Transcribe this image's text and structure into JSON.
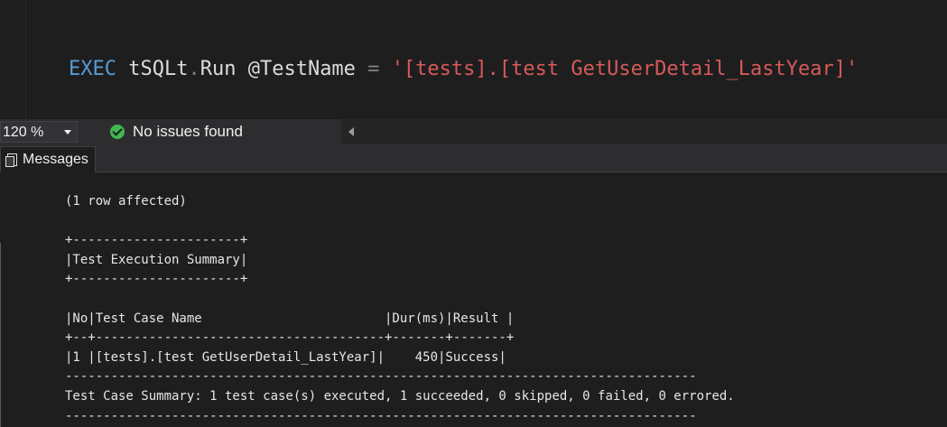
{
  "editor": {
    "code": {
      "keyword": "EXEC",
      "object": "tSQLt",
      "dot": ".",
      "procedure": "Run",
      "param": "@TestName",
      "equals": "=",
      "value": "'[tests].[test GetUserDetail_LastYear]'"
    },
    "colors": {
      "keyword": "#569cd6",
      "string": "#d65a5a",
      "operator": "#7f7f7f"
    }
  },
  "statusbar": {
    "zoom": "120 %",
    "issues_text": "No issues found",
    "issues_icon": "check-circle-icon",
    "issues_color": "#3fb950"
  },
  "results": {
    "tabs": [
      {
        "label": "Messages",
        "icon": "messages-icon"
      }
    ]
  },
  "messages": {
    "lines": [
      "(1 row affected)",
      "",
      "+----------------------+",
      "|Test Execution Summary|",
      "+----------------------+",
      "",
      "|No|Test Case Name                        |Dur(ms)|Result |",
      "+--+--------------------------------------+-------+-------+",
      "|1 |[tests].[test GetUserDetail_LastYear]|    450|Success|",
      "-----------------------------------------------------------------------------------",
      "Test Case Summary: 1 test case(s) executed, 1 succeeded, 0 skipped, 0 failed, 0 errored.",
      "-----------------------------------------------------------------------------------"
    ]
  }
}
